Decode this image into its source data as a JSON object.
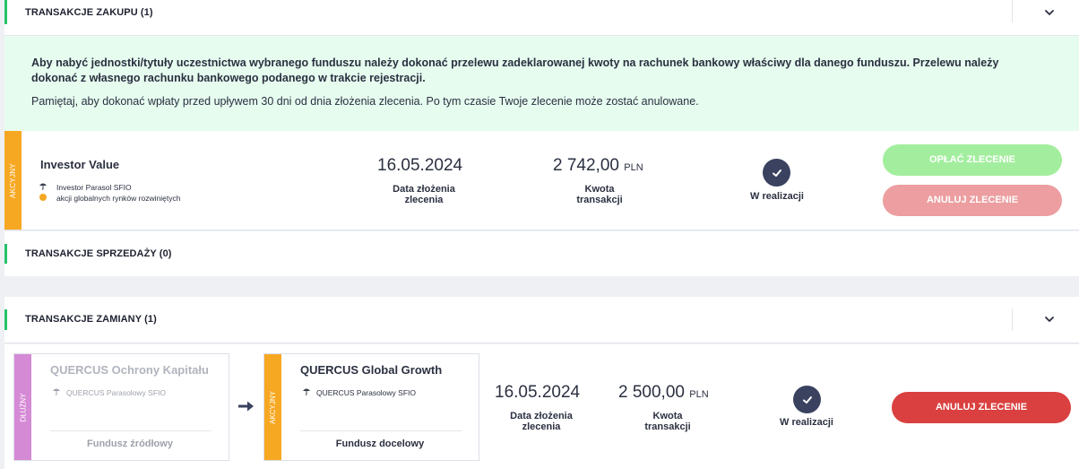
{
  "purchase": {
    "header": "TRANSAKCJE ZAKUPU (1)",
    "banner_line1": "Aby nabyć jednostki/tytuły uczestnictwa wybranego funduszu należy dokonać przelewu zadeklarowanej kwoty na rachunek bankowy właściwy dla danego funduszu. Przelewu należy dokonać z własnego rachunku bankowego podanego w trakcie rejestracji.",
    "banner_line2": "Pamiętaj, aby dokonać wpłaty przed upływem 30 dni od dnia złożenia zlecenia. Po tym czasie Twoje zlecenie może zostać anulowane.",
    "order": {
      "tag": "AKCYJNY",
      "fund_name": "Investor Value",
      "fund_company": "Investor Parasol SFIO",
      "fund_category": "akcji globalnych rynków rozwiniętych",
      "date": "16.05.2024",
      "date_label_1": "Data złożenia",
      "date_label_2": "zlecenia",
      "amount": "2 742,00",
      "currency": "PLN",
      "amount_label_1": "Kwota",
      "amount_label_2": "transakcji",
      "status": "W realizacji",
      "pay_button": "OPŁAĆ ZLECENIE",
      "cancel_button": "ANULUJ ZLECENIE"
    }
  },
  "sale": {
    "header": "TRANSAKCJE SPRZEDAŻY (0)"
  },
  "switch": {
    "header": "TRANSAKCJE ZAMIANY (1)",
    "source": {
      "tag": "DŁUŻNY",
      "fund_name": "QUERCUS Ochrony Kapitału",
      "fund_company": "QUERCUS Parasolowy SFIO",
      "footer": "Fundusz źródłowy"
    },
    "target": {
      "tag": "AKCYJNY",
      "fund_name": "QUERCUS Global Growth",
      "fund_company": "QUERCUS Parasolowy SFIO",
      "footer": "Fundusz docelowy"
    },
    "date": "16.05.2024",
    "date_label_1": "Data złożenia",
    "date_label_2": "zlecenia",
    "amount": "2 500,00",
    "currency": "PLN",
    "amount_label_1": "Kwota",
    "amount_label_2": "transakcji",
    "status": "W realizacji",
    "cancel_button": "ANULUJ ZLECENIE"
  },
  "icons": {
    "expand": "chevron-down-icon",
    "status": "check-circle-icon",
    "fund_company": "umbrella-icon",
    "category": "orange-dot-icon",
    "switch_arrow": "arrow-right-icon"
  },
  "colors": {
    "accent_green": "#25c36b",
    "banner_bg": "#e6fcef",
    "equity_tag": "#f7a823",
    "debt_tag": "#d58ad6",
    "pay_button": "#a3ee9e",
    "cancel_button_disabled": "#ec9ea0",
    "cancel_button_active": "#d9403f",
    "status_circle": "#3a4260"
  }
}
